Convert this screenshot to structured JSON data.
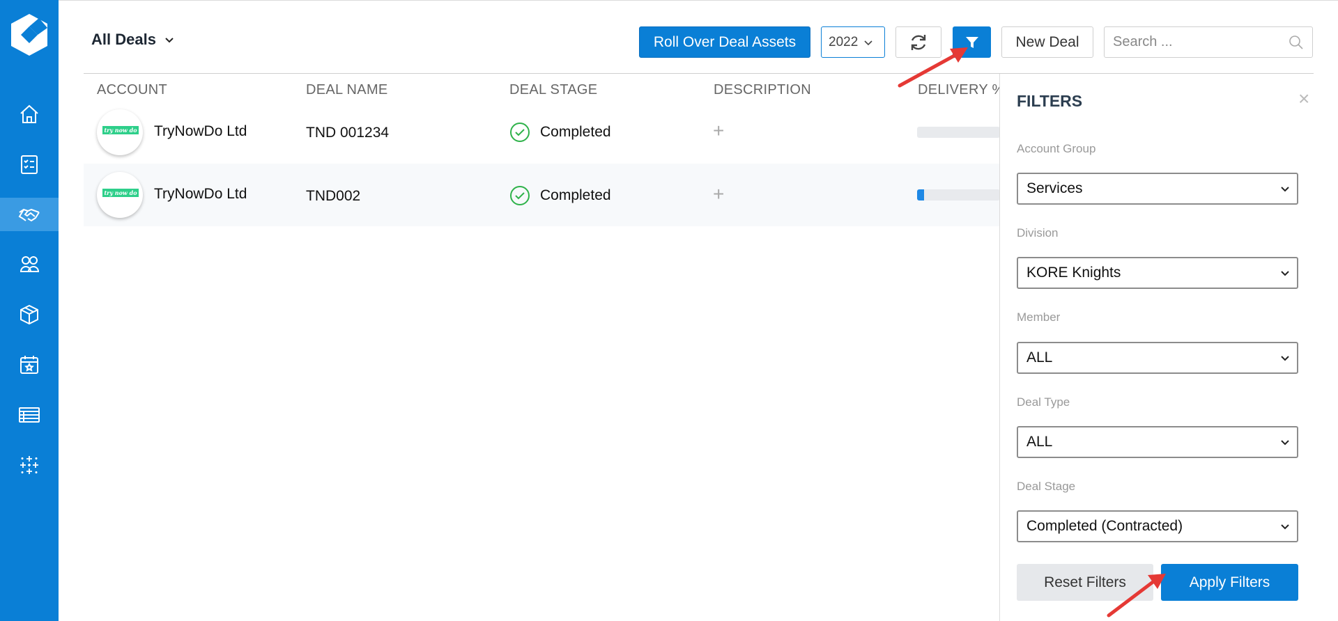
{
  "header": {
    "title": "All Deals",
    "roll_over_label": "Roll Over Deal Assets",
    "year_value": "2022",
    "new_deal_label": "New Deal",
    "search_placeholder": "Search ..."
  },
  "table": {
    "columns": [
      "ACCOUNT",
      "DEAL NAME",
      "DEAL STAGE",
      "DESCRIPTION",
      "DELIVERY %"
    ],
    "rows": [
      {
        "logo_text": "try now do",
        "account": "TryNowDo Ltd",
        "deal_name": "TND 001234",
        "stage": "Completed",
        "description": "+",
        "delivery": 0
      },
      {
        "logo_text": "try now do",
        "account": "TryNowDo Ltd",
        "deal_name": "TND002",
        "stage": "Completed",
        "description": "+",
        "delivery": 0.08
      }
    ]
  },
  "filters": {
    "title": "FILTERS",
    "close": "×",
    "account_group": {
      "label": "Account Group",
      "value": "Services"
    },
    "division": {
      "label": "Division",
      "value": "KORE Knights"
    },
    "member": {
      "label": "Member",
      "value": "ALL"
    },
    "deal_type": {
      "label": "Deal Type",
      "value": "ALL"
    },
    "deal_stage": {
      "label": "Deal Stage",
      "value": "Completed (Contracted)"
    },
    "reset_label": "Reset Filters",
    "apply_label": "Apply Filters"
  },
  "sidebar": {
    "items": [
      "home-icon",
      "tasks-icon",
      "deals-icon",
      "contacts-icon",
      "inventory-icon",
      "calendar-icon",
      "table-icon",
      "sparkle-icon"
    ],
    "active": "deals-icon"
  },
  "colors": {
    "primary": "#0a7fd6",
    "success": "#2fb24a",
    "annotation": "#e53935"
  }
}
